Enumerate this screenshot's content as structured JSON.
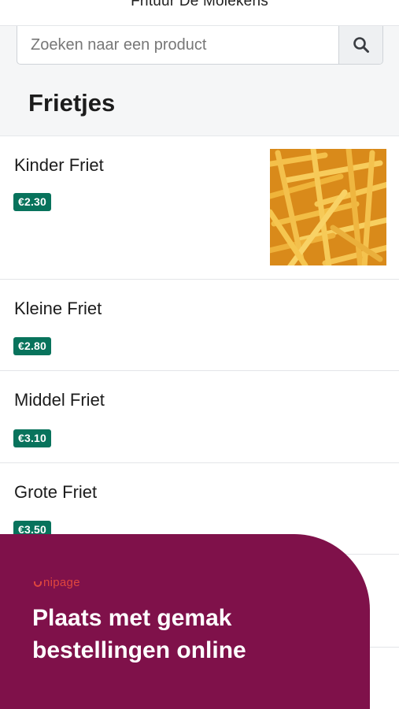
{
  "header": {
    "title": "Frituur De Molekens"
  },
  "search": {
    "placeholder": "Zoeken naar een product",
    "button_icon": "search-icon"
  },
  "section": {
    "title": "Frietjes"
  },
  "products": [
    {
      "name": "Kinder Friet",
      "price": "€2.30",
      "has_image": true
    },
    {
      "name": "Kleine Friet",
      "price": "€2.80"
    },
    {
      "name": "Middel Friet",
      "price": "€3.10"
    },
    {
      "name": "Grote Friet",
      "price": "€3.50"
    }
  ],
  "promo": {
    "brand": "nipage",
    "headline": "Plaats met gemak\nbestellingen online"
  },
  "colors": {
    "price_badge": "#08735c",
    "promo_bg": "#7f114a",
    "promo_brand": "#e0463e"
  }
}
